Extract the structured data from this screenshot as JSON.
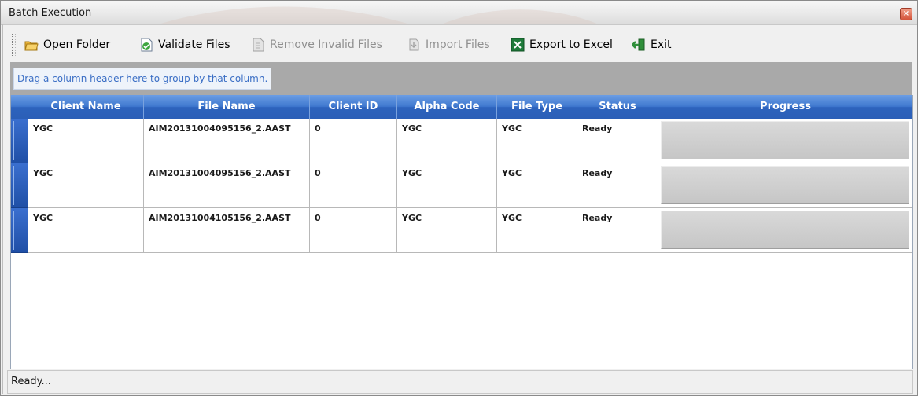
{
  "window": {
    "title": "Batch Execution",
    "close_symbol": "×"
  },
  "toolbar": {
    "items": [
      {
        "label": "Open Folder",
        "icon": "open-folder-icon",
        "enabled": true
      },
      {
        "label": "Validate Files",
        "icon": "validate-files-icon",
        "enabled": true
      },
      {
        "label": "Remove Invalid Files",
        "icon": "remove-files-icon",
        "enabled": false
      },
      {
        "label": "Import Files",
        "icon": "import-files-icon",
        "enabled": false
      },
      {
        "label": "Export to Excel",
        "icon": "excel-icon",
        "enabled": true
      },
      {
        "label": "Exit",
        "icon": "exit-icon",
        "enabled": true
      }
    ]
  },
  "grid": {
    "group_hint": "Drag a column header here to group by that column.",
    "columns": [
      "Client Name",
      "File Name",
      "Client ID",
      "Alpha Code",
      "File Type",
      "Status",
      "Progress"
    ],
    "rows": [
      {
        "client_name": "YGC",
        "file_name": "AIM20131004095156_2.AAST",
        "client_id": "0",
        "alpha_code": "YGC",
        "file_type": "YGC",
        "status": "Ready",
        "progress": 0
      },
      {
        "client_name": "YGC",
        "file_name": "AIM20131004095156_2.AAST",
        "client_id": "0",
        "alpha_code": "YGC",
        "file_type": "YGC",
        "status": "Ready",
        "progress": 0
      },
      {
        "client_name": "YGC",
        "file_name": "AIM20131004105156_2.AAST",
        "client_id": "0",
        "alpha_code": "YGC",
        "file_type": "YGC",
        "status": "Ready",
        "progress": 0
      }
    ]
  },
  "statusbar": {
    "text": "Ready..."
  },
  "colors": {
    "header_blue": "#3f78cf",
    "group_area": "#a9a9a9",
    "hint_text": "#3a6ec5",
    "disabled_text": "#8f8f8f"
  }
}
